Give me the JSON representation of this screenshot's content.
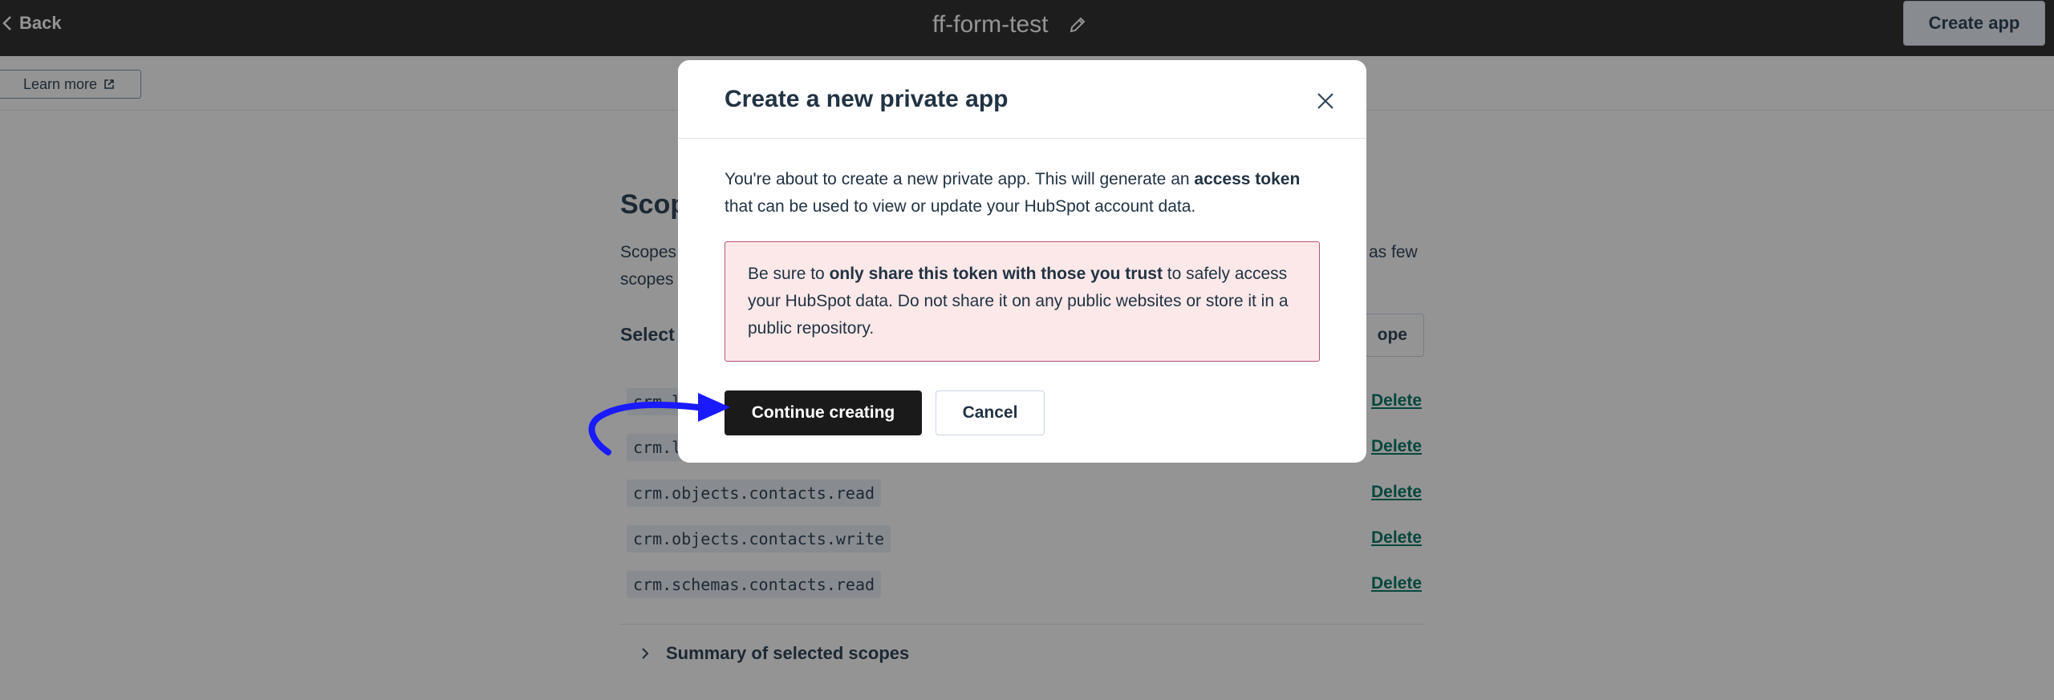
{
  "header": {
    "back_label": "Back",
    "app_title": "ff-form-test",
    "create_app_label": "Create app"
  },
  "subbar": {
    "learn_more_label": "Learn more"
  },
  "scopes": {
    "heading": "Scop",
    "description_left_1": "Scopes",
    "description_left_2": "scopes",
    "description_right": "as few",
    "selected_heading": "Select",
    "add_scope_label": "ope",
    "delete_label": "Delete",
    "items": [
      "crm.l",
      "crm.l",
      "crm.objects.contacts.read",
      "crm.objects.contacts.write",
      "crm.schemas.contacts.read"
    ],
    "summary_label": "Summary of selected scopes"
  },
  "modal": {
    "title": "Create a new private app",
    "intro_part1": "You're about to create a new private app. This will generate an ",
    "intro_bold": "access token",
    "intro_part2": "that can be used to view or update your HubSpot account data.",
    "warning_part1": "Be sure to ",
    "warning_bold": "only share this token with those you trust",
    "warning_part2": " to safely access your HubSpot data. Do not share it on any public websites or store it in a public repository.",
    "continue_label": "Continue creating",
    "cancel_label": "Cancel"
  },
  "colors": {
    "header_bg": "#333333",
    "primary_button": "#1a1a1a",
    "warning_bg": "#fde8e9",
    "warning_border": "#b05478",
    "link": "#0b7a6a",
    "annotation": "#1a1aff"
  }
}
